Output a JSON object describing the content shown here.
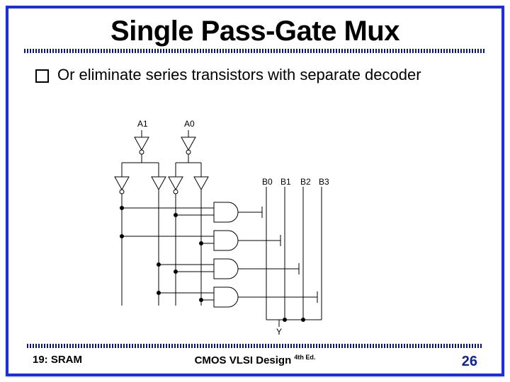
{
  "title": "Single Pass-Gate Mux",
  "bullet": "Or eliminate series transistors with separate decoder",
  "labels": {
    "a1": "A1",
    "a0": "A0",
    "b0": "B0",
    "b1": "B1",
    "b2": "B2",
    "b3": "B3",
    "y": "Y"
  },
  "footer": {
    "left": "19: SRAM",
    "center": "CMOS VLSI Design",
    "edition": "4th Ed.",
    "page": "26"
  }
}
